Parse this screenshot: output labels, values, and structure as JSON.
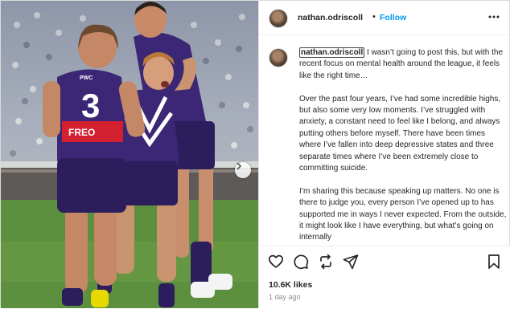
{
  "post": {
    "username": "nathan.odriscoll",
    "separator": "•",
    "follow_label": "Follow",
    "caption_username": "nathan.odriscoll",
    "caption_paragraphs": [
      "I wasn’t going to post this, but with the recent focus on mental health around the league, it feels like the right time…",
      "Over the past four years, I’ve had some incredible highs, but also some very low moments. I’ve struggled with anxiety, a constant need to feel like I belong, and always putting others before myself. There have been times where I’ve fallen into deep depressive states and three separate times where I’ve been extremely close to committing suicide.",
      "I’m sharing this because speaking up matters. No one is there to judge you, every person I’ve opened up to has supported me in ways I never expected. From the outside, it might look like I have everything, but what’s going on internally"
    ],
    "likes": "10.6K likes",
    "time": "1 day ago"
  },
  "photo": {
    "jersey_number": "3",
    "sponsor_text": "FREO",
    "chest_text": "PWC",
    "carousel_icon": "chevron-right-icon"
  },
  "actions": [
    "heart-icon",
    "comment-icon",
    "share-icon",
    "send-icon",
    "bookmark-icon",
    "more-icon"
  ],
  "colors": {
    "follow": "#0095f6",
    "text": "#262626",
    "muted": "#8e8e8e",
    "purple": "#2c1d5c",
    "sponsor_red": "#d3202f"
  }
}
